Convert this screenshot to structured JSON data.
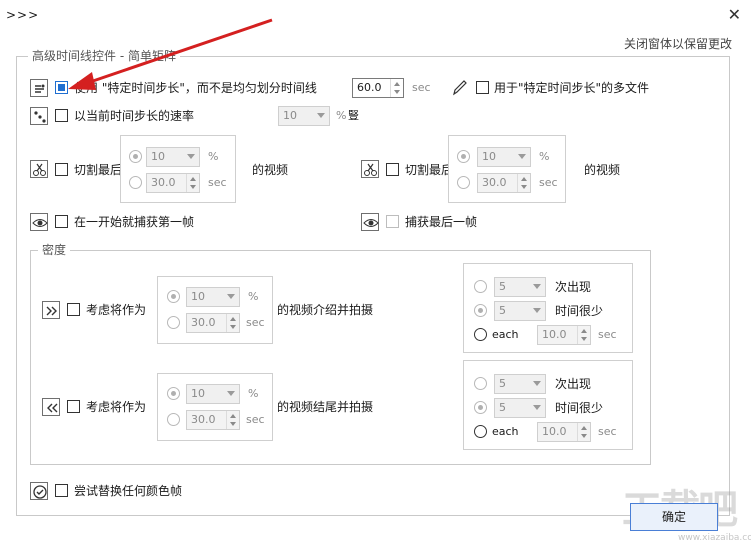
{
  "window": {
    "title": ">>>",
    "close_glyph": "✕"
  },
  "hint_text": "关闭窗体以保留更改",
  "advanced_group": {
    "legend": "高级时间线控件 - 简单矩阵"
  },
  "row1": {
    "label": "使用 \"特定时间步长\"，而不是均匀划分时间线",
    "checked": true,
    "value": "60.0",
    "unit": "sec"
  },
  "row1_right": {
    "label": "用于\"特定时间步长\"的多文件",
    "checked": false
  },
  "row2": {
    "label": "以当前时间步长的速率",
    "combo_value": "10",
    "unit": "%",
    "unit_suffix": "豎"
  },
  "cut_first": {
    "label": "切割最后",
    "suffix": "的视频",
    "percent_value": "10",
    "percent_unit": "%",
    "sec_value": "30.0",
    "sec_unit": "sec"
  },
  "cut_last": {
    "label": "切割最后",
    "suffix": "的视频",
    "percent_value": "10",
    "percent_unit": "%",
    "sec_value": "30.0",
    "sec_unit": "sec"
  },
  "capture_first": {
    "label": "在一开始就捕获第一帧"
  },
  "capture_last": {
    "label": "捕获最后一帧"
  },
  "density_group": {
    "legend": "密度"
  },
  "intro": {
    "label": "考虑将作为",
    "suffix": "的视频介绍并拍摄",
    "percent_value": "10",
    "percent_unit": "%",
    "sec_value": "30.0",
    "sec_unit": "sec",
    "times_value": "5",
    "times_label": "次出现",
    "min_value": "5",
    "min_label": "时间很少",
    "each_label": "each",
    "each_value": "10.0",
    "each_unit": "sec"
  },
  "outro": {
    "label": "考虑将作为",
    "suffix": "的视频结尾并拍摄",
    "percent_value": "10",
    "percent_unit": "%",
    "sec_value": "30.0",
    "sec_unit": "sec",
    "times_value": "5",
    "times_label": "次出现",
    "min_value": "5",
    "min_label": "时间很少",
    "each_label": "each",
    "each_value": "10.0",
    "each_unit": "sec"
  },
  "replace_color": {
    "label": "尝试替换任何颜色帧"
  },
  "ok_button": {
    "label": "确定"
  },
  "watermark": {
    "text": "工载吧",
    "url": "www.xiazaiba.com"
  },
  "colors": {
    "accent": "#1f6fd1",
    "annotation_arrow": "#d42020",
    "disabled_text": "#8a8a8a"
  },
  "icons": [
    "timestep-icon",
    "rate-dice-icon",
    "cut-first-icon",
    "cut-last-icon",
    "eye-first-icon",
    "eye-last-icon",
    "intro-arrows-icon",
    "outro-arrows-icon",
    "replace-color-icon",
    "pen-icon"
  ]
}
